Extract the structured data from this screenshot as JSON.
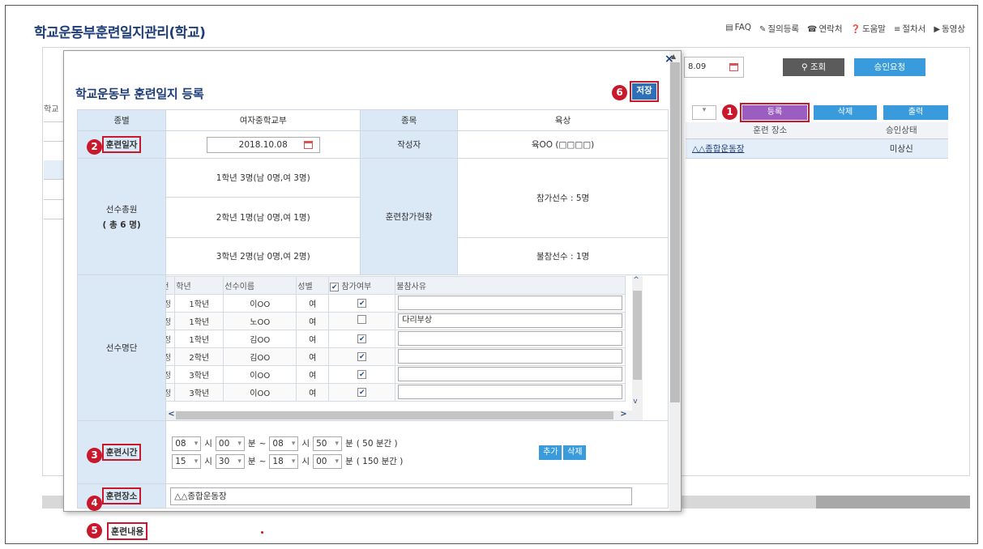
{
  "app": {
    "title": "학교운동부훈련일지관리(학교)",
    "top_links": [
      {
        "icon": "faq-icon",
        "glyph": "▤",
        "label": "FAQ"
      },
      {
        "icon": "pencil-icon",
        "glyph": "✎",
        "label": "질의등록"
      },
      {
        "icon": "phone-icon",
        "glyph": "☎",
        "label": "연락처"
      },
      {
        "icon": "help-icon",
        "glyph": "❓",
        "label": "도움말"
      },
      {
        "icon": "list-icon",
        "glyph": "≡",
        "label": "절차서"
      },
      {
        "icon": "video-icon",
        "glyph": "▶",
        "label": "동영상"
      }
    ]
  },
  "background": {
    "date_partial": "8.09",
    "search_label": "조회",
    "approve_label": "승인요청",
    "register_label": "등록",
    "delete_label": "삭제",
    "print_label": "출력",
    "left_col_label": "학교",
    "table": {
      "headers": [
        "훈련 장소",
        "승인상태"
      ],
      "rows": [
        {
          "place": "△△종합운동장",
          "status": "미상신"
        }
      ]
    }
  },
  "steps": [
    "1",
    "2",
    "3",
    "4",
    "5",
    "6"
  ],
  "modal": {
    "title": "학교운동부 훈련일지 등록",
    "save_label": "저장",
    "close_glyph": "×",
    "labels": {
      "category": "종별",
      "event": "종목",
      "train_date": "훈련일자",
      "writer": "작성자",
      "total": "선수총원",
      "total_sub": "( 총 6 명)",
      "participation": "훈련참가현황",
      "roster": "선수명단",
      "train_time": "훈련시간",
      "train_place": "훈련장소",
      "train_content": "훈련내용"
    },
    "values": {
      "category": "여자중학교부",
      "event": "육상",
      "train_date": "2018.10.08",
      "writer": "육OO (□□□□)",
      "grade1": "1학년 3명(남 0명,여 3명)",
      "grade2": "2학년 1명(남 0명,여 1명)",
      "grade3": "3학년 2명(남 0명,여 2명)",
      "participants": "참가선수 : 5명",
      "absentees": "불참선수 : 1명",
      "train_place": "△△종합운동장"
    },
    "roster": {
      "headers": [
        "번",
        "학년",
        "선수이름",
        "성별",
        "참가여부",
        "불참사유"
      ],
      "rows": [
        {
          "pre": "정",
          "grade": "1학년",
          "name": "이OO",
          "gender": "여",
          "checked": "✔",
          "reason": ""
        },
        {
          "pre": "정",
          "grade": "1학년",
          "name": "노OO",
          "gender": "여",
          "checked": "",
          "reason": "다리부상"
        },
        {
          "pre": "정",
          "grade": "1학년",
          "name": "김OO",
          "gender": "여",
          "checked": "✔",
          "reason": ""
        },
        {
          "pre": "정",
          "grade": "2학년",
          "name": "김OO",
          "gender": "여",
          "checked": "✔",
          "reason": ""
        },
        {
          "pre": "정",
          "grade": "3학년",
          "name": "이OO",
          "gender": "여",
          "checked": "✔",
          "reason": ""
        },
        {
          "pre": "정",
          "grade": "3학년",
          "name": "이OO",
          "gender": "여",
          "checked": "✔",
          "reason": ""
        }
      ]
    },
    "time_rows": [
      {
        "sh": "08",
        "sm": "00",
        "eh": "08",
        "em": "50",
        "dur": "( 50 분간 )"
      },
      {
        "sh": "15",
        "sm": "30",
        "eh": "18",
        "em": "00",
        "dur": "( 150 분간 )"
      }
    ],
    "time_units": {
      "hour": "시",
      "minute": "분",
      "tilde": "~"
    },
    "add_label": "추가",
    "del_label": "삭제"
  }
}
